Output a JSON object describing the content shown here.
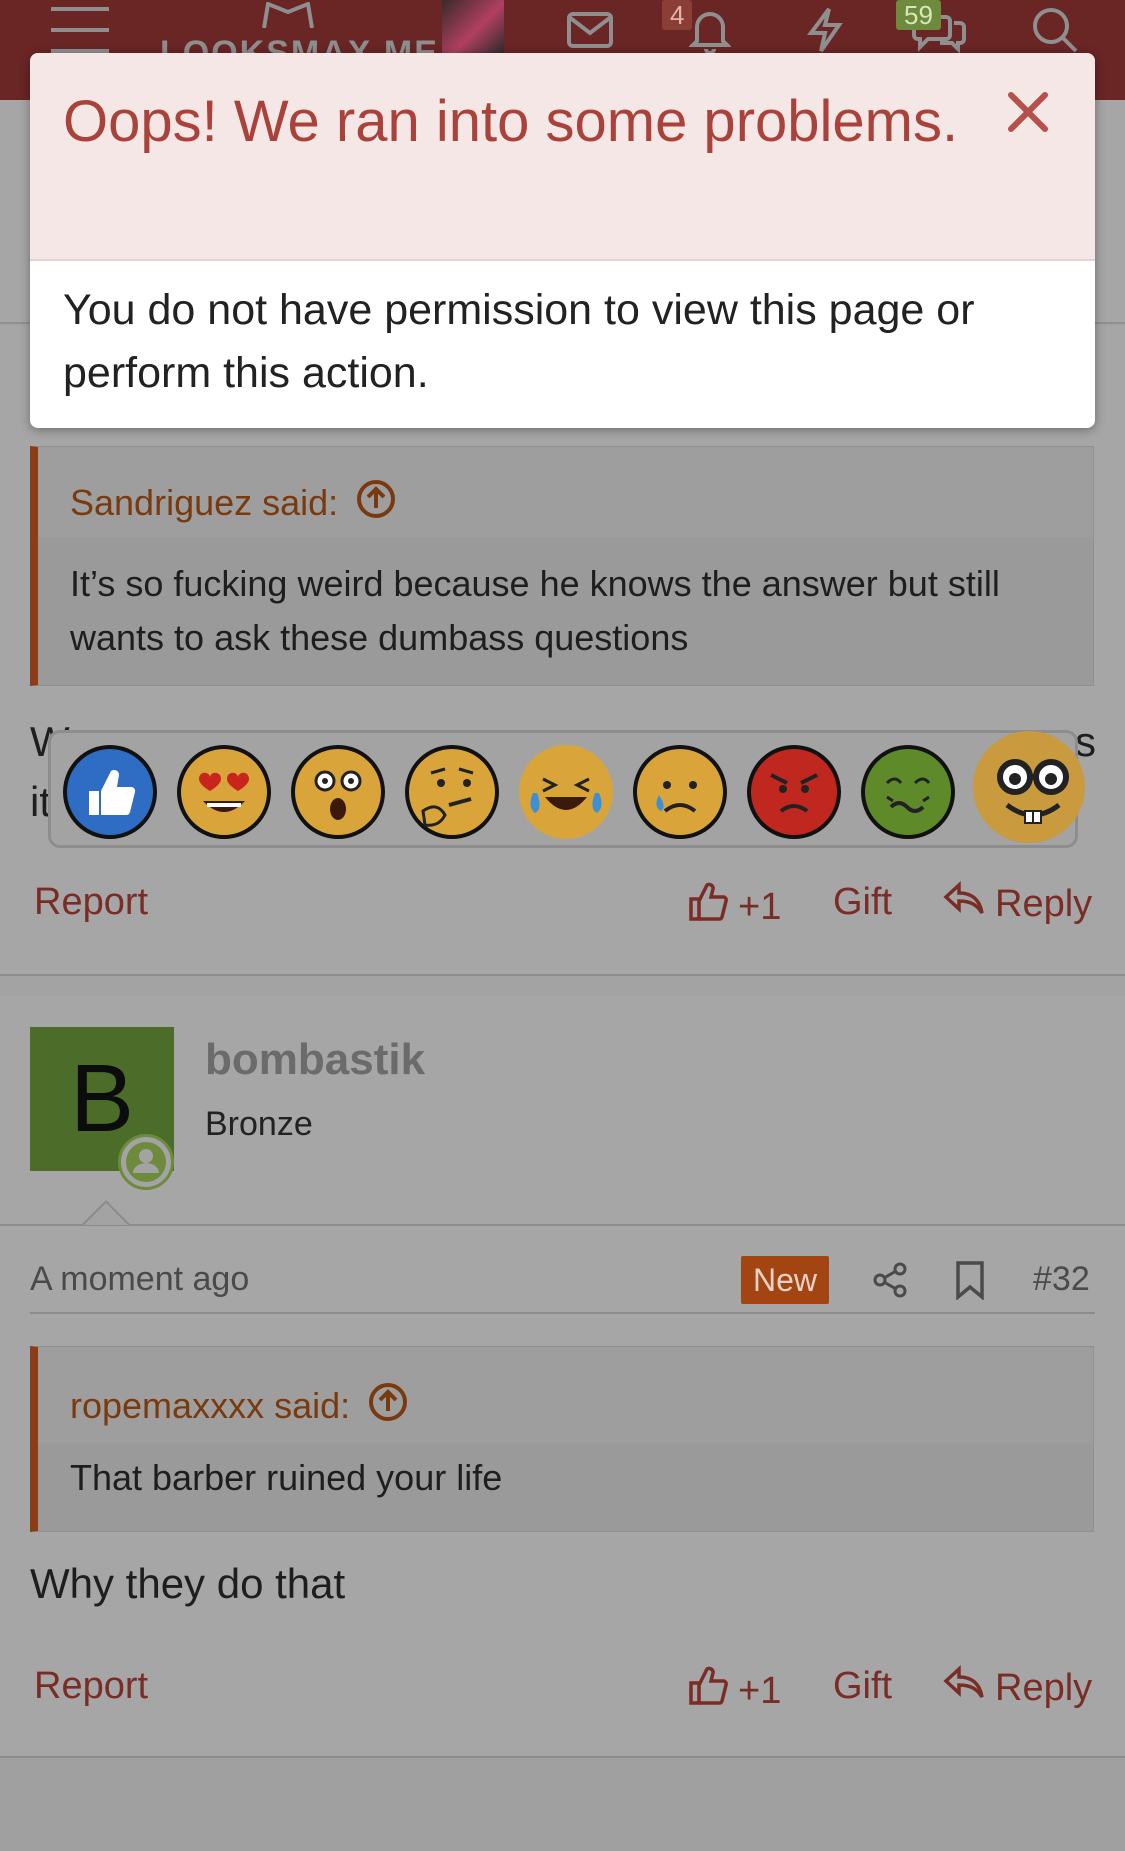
{
  "topbar": {
    "logo_text": "LOOKSMAX.ME",
    "alerts_count": "4",
    "conversations_count": "59"
  },
  "error_modal": {
    "title": "Oops! We ran into some problems.",
    "message": "You do not have permission to view this page or perform this action.",
    "close_icon": "×"
  },
  "post_31": {
    "quote_author": "Sandriguez said:",
    "quote_text": "It’s so fucking weird because he knows the answer but still wants to ask these dumbass questions",
    "body_fragment_1": "W",
    "body_fragment_2": "it",
    "body_fragment_3": "s",
    "reactions": [
      "like",
      "love",
      "wow",
      "thinking",
      "laugh",
      "sad",
      "angry",
      "sick",
      "nerd"
    ],
    "actions": {
      "report": "Report",
      "like": "+1",
      "gift": "Gift",
      "reply": "Reply"
    }
  },
  "post_32": {
    "avatar_letter": "B",
    "username": "bombastik",
    "user_title": "Bronze",
    "timestamp": "A moment ago",
    "new_badge": "New",
    "post_number": "#32",
    "quote_author": "ropemaxxxx said:",
    "quote_text": "That barber ruined your life",
    "body": "Why they do that",
    "actions": {
      "report": "Report",
      "like": "+1",
      "gift": "Gift",
      "reply": "Reply"
    }
  },
  "colors": {
    "brand": "#6a2525",
    "modal_title": "#a9423b",
    "accent_link": "#7a2c26",
    "quote_border": "#8a3d16",
    "new_badge": "#a24513"
  }
}
